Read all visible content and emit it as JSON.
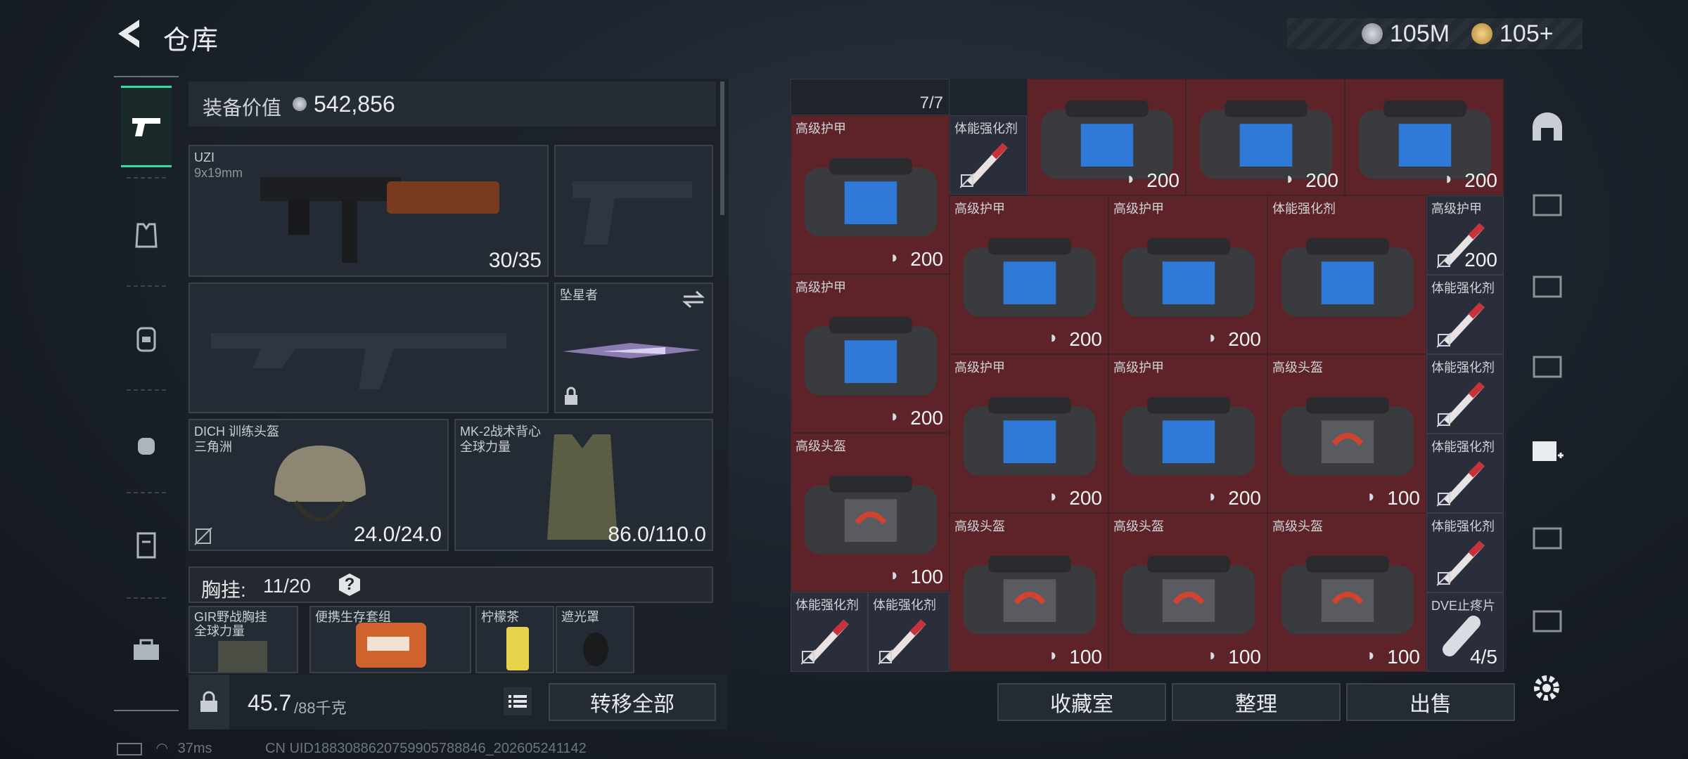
{
  "header": {
    "title": "仓库"
  },
  "currency": {
    "primary": "105M",
    "secondary": "105+"
  },
  "equipment": {
    "value_label": "装备价值",
    "value": "542,856",
    "primary_weapon": {
      "name": "UZI",
      "caliber": "9x19mm",
      "ammo": "30/35"
    },
    "melee": {
      "name": "坠星者"
    },
    "helmet": {
      "name": "DICH 训练头盔",
      "faction": "三角洲",
      "durability": "24.0/24.0"
    },
    "vest": {
      "name": "MK-2战术背心",
      "faction": "全球力量",
      "durability": "86.0/110.0"
    },
    "chest_rig_label": "胸挂:",
    "chest_rig_count": "11/20",
    "help": "?",
    "rig_items": [
      {
        "name": "GIR野战胸挂",
        "sub": "全球力量"
      },
      {
        "name": "便携生存套组"
      },
      {
        "name": "柠檬茶"
      },
      {
        "name": "遮光罩"
      }
    ],
    "weight": "45.7",
    "weight_cap": "/88千克",
    "transfer_all": "转移全部"
  },
  "storage": {
    "top_stack": "7/7",
    "cells": [
      {
        "title": "高级护甲",
        "value": "200"
      },
      {
        "title": "体能强化剂",
        "value": ""
      },
      {
        "title": "",
        "value": "200"
      },
      {
        "title": "",
        "value": "200"
      },
      {
        "title": "",
        "value": "200"
      },
      {
        "title": "高级护甲",
        "value": "200"
      },
      {
        "title": "高级护甲",
        "value": "200"
      },
      {
        "title": "高级护甲",
        "value": "200"
      },
      {
        "title": "体能强化剂",
        "value": ""
      },
      {
        "title": "高级护甲",
        "value": "200"
      },
      {
        "title": "体能强化剂",
        "value": ""
      },
      {
        "title": "高级护甲",
        "value": "200"
      },
      {
        "title": "高级护甲",
        "value": "200"
      },
      {
        "title": "高级头盔",
        "value": "100"
      },
      {
        "title": "体能强化剂",
        "value": ""
      },
      {
        "title": "高级头盔",
        "value": "100"
      },
      {
        "title": "体能强化剂",
        "value": ""
      },
      {
        "title": "高级头盔",
        "value": "100"
      },
      {
        "title": "高级头盔",
        "value": "100"
      },
      {
        "title": "高级头盔",
        "value": "100"
      },
      {
        "title": "体能强化剂",
        "value": ""
      },
      {
        "title": "体能强化剂",
        "value": ""
      },
      {
        "title": "体能强化剂",
        "value": ""
      },
      {
        "title": "DVE止疼片",
        "value": "4/5"
      }
    ],
    "buttons": {
      "collection": "收藏室",
      "sort": "整理",
      "sell": "出售"
    }
  },
  "status": {
    "ping": "37ms",
    "uid": "CN UID1883088620759905788846_202605241142"
  },
  "colors": {
    "accent": "#2fe0a6",
    "cell_red": "#5e2328",
    "cell_dark": "#2a2d3a"
  }
}
